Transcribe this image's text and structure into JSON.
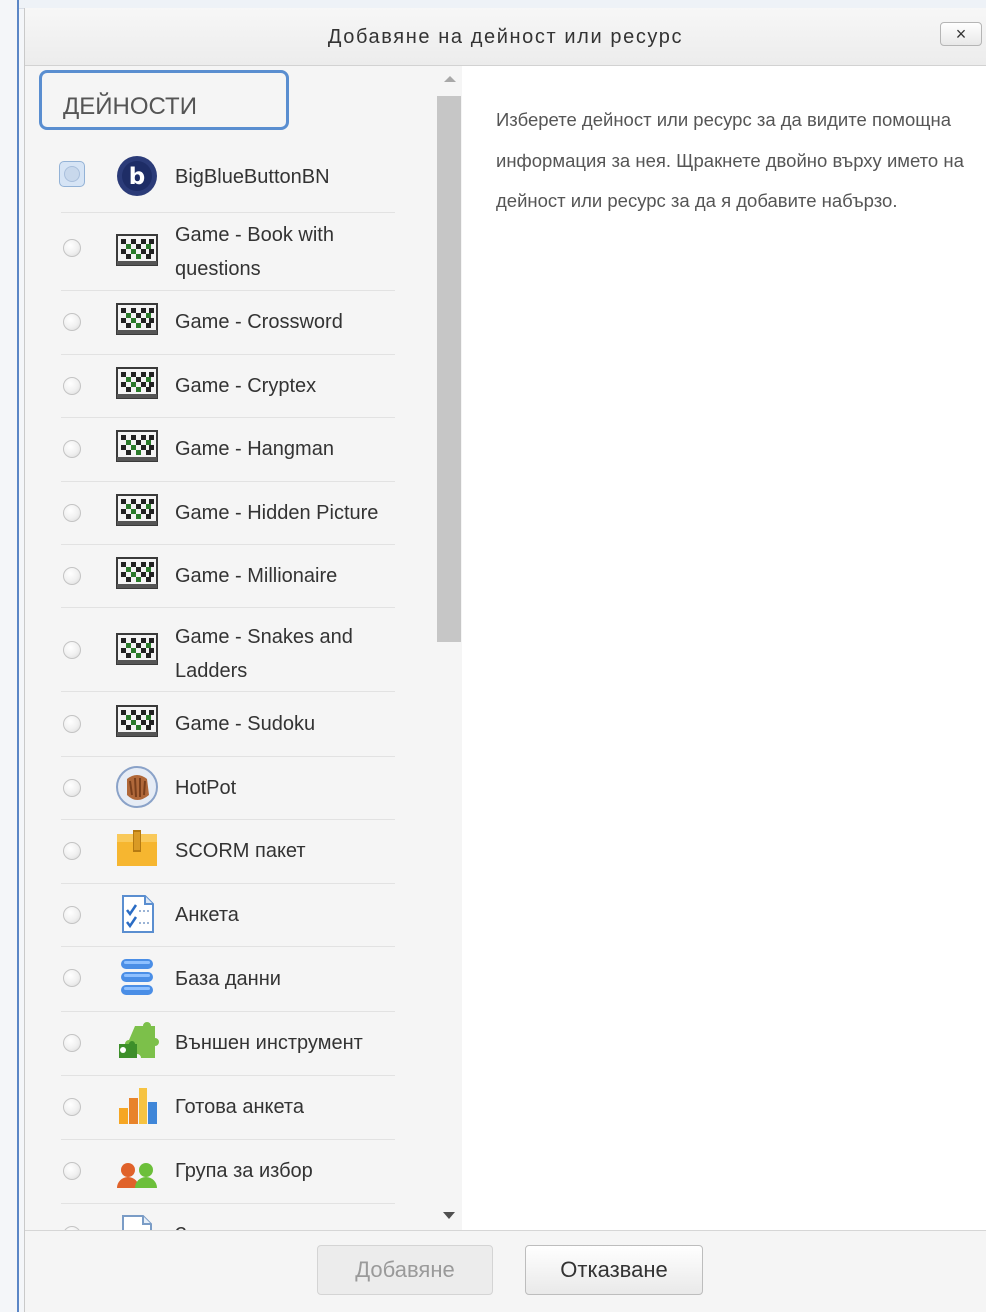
{
  "dialog": {
    "title": "Добавяне на дейност или ресурс",
    "close_label": "×"
  },
  "activities": {
    "section_title": "ДЕЙНОСТИ",
    "items": [
      {
        "label": "BigBlueButtonBN",
        "icon": "bigbluebutton-icon",
        "selected": true
      },
      {
        "label": "Game - Book with questions",
        "icon": "game-icon"
      },
      {
        "label": "Game - Crossword",
        "icon": "game-icon"
      },
      {
        "label": "Game - Cryptex",
        "icon": "game-icon"
      },
      {
        "label": "Game - Hangman",
        "icon": "game-icon"
      },
      {
        "label": "Game - Hidden Picture",
        "icon": "game-icon"
      },
      {
        "label": "Game - Millionaire",
        "icon": "game-icon"
      },
      {
        "label": "Game - Snakes and Ladders",
        "icon": "game-icon"
      },
      {
        "label": "Game - Sudoku",
        "icon": "game-icon"
      },
      {
        "label": "HotPot",
        "icon": "hotpot-icon"
      },
      {
        "label": "SCORM пакет",
        "icon": "scorm-package-icon"
      },
      {
        "label": "Анкета",
        "icon": "survey-icon"
      },
      {
        "label": "База данни",
        "icon": "database-icon"
      },
      {
        "label": "Външен инструмент",
        "icon": "external-tool-icon"
      },
      {
        "label": "Готова анкета",
        "icon": "feedback-chart-icon"
      },
      {
        "label": "Група за избор",
        "icon": "group-choice-icon"
      },
      {
        "label": "Задание",
        "icon": "assignment-icon"
      }
    ]
  },
  "help": {
    "text": "Изберете дейност или ресурс за да видите помощна информация за нея. Щракнете двойно върху името на дейност или ресурс за да я добавите набързо."
  },
  "footer": {
    "add_label": "Добавяне",
    "cancel_label": "Отказване"
  },
  "colors": {
    "focus_outline": "#5a8ed0",
    "panel_background": "#f5f5f5"
  }
}
